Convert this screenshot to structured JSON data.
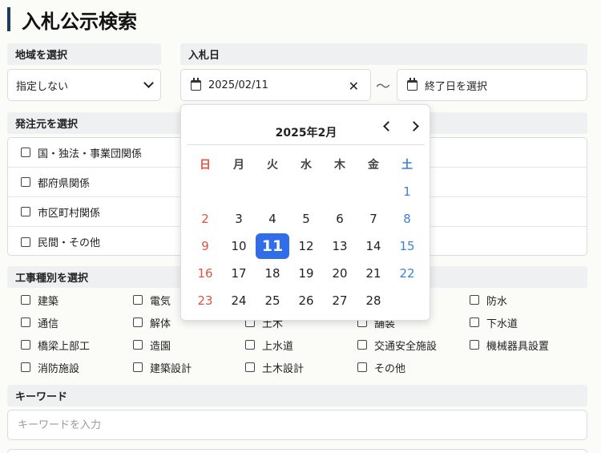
{
  "page": {
    "title": "入札公示検索",
    "accent_color": "#1f3a5f"
  },
  "region": {
    "label": "地域を選択",
    "selected": "指定しない"
  },
  "bid_date": {
    "label": "入札日",
    "from_value": "2025/02/11",
    "separator": "～",
    "to_placeholder": "終了日を選択"
  },
  "calendar": {
    "title": "2025年2月",
    "weekdays": [
      "日",
      "月",
      "火",
      "水",
      "木",
      "金",
      "土"
    ],
    "first_weekday_index": 6,
    "days_in_month": 28,
    "selected_day": 11,
    "selected_color": "#2f6ee8",
    "sunday_color": "#e0533d",
    "saturday_color": "#3d7fe0"
  },
  "orderer": {
    "label": "発注元を選択",
    "options": [
      "国・独法・事業団関係",
      "都府県関係",
      "市区町村関係",
      "民間・その他"
    ]
  },
  "work_type": {
    "label": "工事種別を選択",
    "options": [
      "建築",
      "電気",
      "",
      "",
      "防水",
      "通信",
      "解体",
      "土木",
      "舗装",
      "下水道",
      "橋梁上部工",
      "造園",
      "上水道",
      "交通安全施設",
      "機械器具設置",
      "消防施設",
      "建築設計",
      "土木設計",
      "その他"
    ]
  },
  "keyword": {
    "label": "キーワード",
    "placeholder": "キーワードを入力"
  }
}
